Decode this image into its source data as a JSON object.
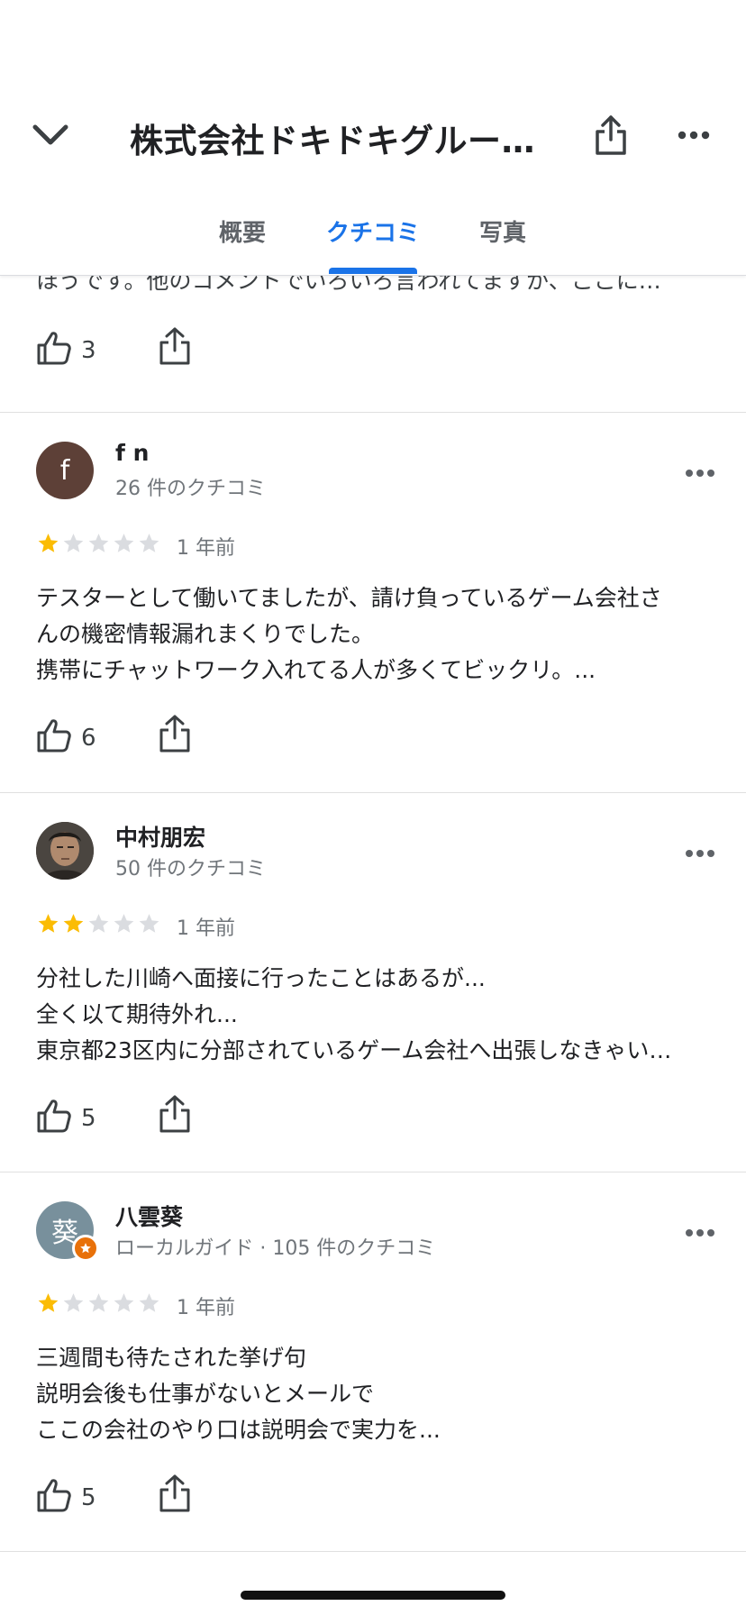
{
  "header": {
    "title": "株式会社ドキドキグルー…",
    "back_icon": "chevron-down-icon",
    "share_icon": "share-icon",
    "more_icon": "more-horizontal-icon"
  },
  "tabs": [
    {
      "label": "概要"
    },
    {
      "label": "クチコミ",
      "active": true
    },
    {
      "label": "写真"
    }
  ],
  "partial_review": {
    "text": "ほうです。他のコメントでいろいろ言われてますが、ここに…",
    "likes": "3"
  },
  "reviews": [
    {
      "avatar_letter": "f",
      "avatar_color": "#5d4037",
      "name": "f n",
      "meta": "26 件のクチコミ",
      "rating": 1,
      "date": "1 年前",
      "lines": [
        "テスターとして働いてましたが、請け負っているゲーム会社さ",
        "んの機密情報漏れまくりでした。",
        "携帯にチャットワーク入れてる人が多くてビックリ。..."
      ],
      "likes": "6"
    },
    {
      "avatar_letter": "",
      "avatar_color": "#3e3a36",
      "name": "中村朋宏",
      "meta": "50 件のクチコミ",
      "rating": 2,
      "date": "1 年前",
      "lines": [
        "分社した川崎へ面接に行ったことはあるが...",
        "全く以て期待外れ...",
        "東京都23区内に分部されているゲーム会社へ出張しなきゃい…"
      ],
      "likes": "5"
    },
    {
      "avatar_letter": "葵",
      "avatar_color": "#78909c",
      "name": "八雲葵",
      "meta": "ローカルガイド · 105 件のクチコミ",
      "rating": 1,
      "date": "1 年前",
      "lines": [
        "三週間も待たされた挙げ句",
        "説明会後も仕事がないとメールで",
        "ここの会社のやり口は説明会で実力を..."
      ],
      "likes": "5"
    }
  ],
  "colors": {
    "accent": "#1a73e8",
    "star_filled": "#fbbc04",
    "star_empty": "#dadce0",
    "local_guide_badge": "#e8710a"
  }
}
